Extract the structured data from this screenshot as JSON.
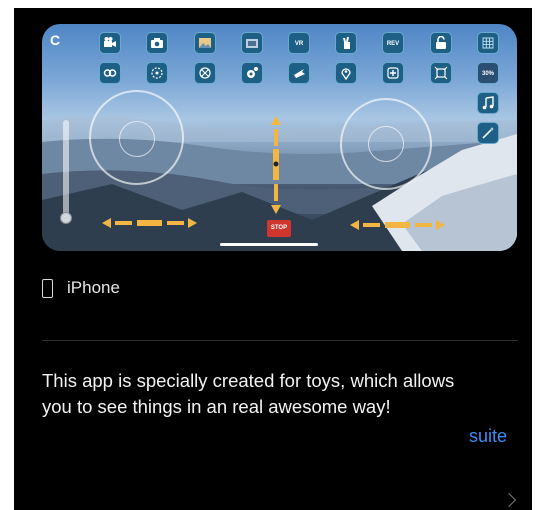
{
  "preview": {
    "c_label": "C",
    "top_icons": [
      "video-camera-icon",
      "camera-icon",
      "gallery-icon",
      "album-icon",
      "vr-icon",
      "gesture-icon",
      "rev-icon",
      "unlock-icon",
      "grid-icon"
    ],
    "second_icons": [
      "loop-icon",
      "headless-icon",
      "rotate-icon",
      "settings-icon",
      "calibrate-icon",
      "location-icon",
      "emergency-icon",
      "fit-screen-icon"
    ],
    "vr_label": "VR",
    "rev_label": "REV",
    "speed_label": "30%",
    "stop_label": "STOP",
    "colors": {
      "button_fill": "#1e5f86",
      "button_border": "#6aa9cf",
      "trim": "#f4b642",
      "stop": "#d0362e"
    }
  },
  "device": {
    "label": "iPhone"
  },
  "description": "This app is specially created for toys, which allows you to see things in an real awesome way!",
  "more_link": "suite"
}
